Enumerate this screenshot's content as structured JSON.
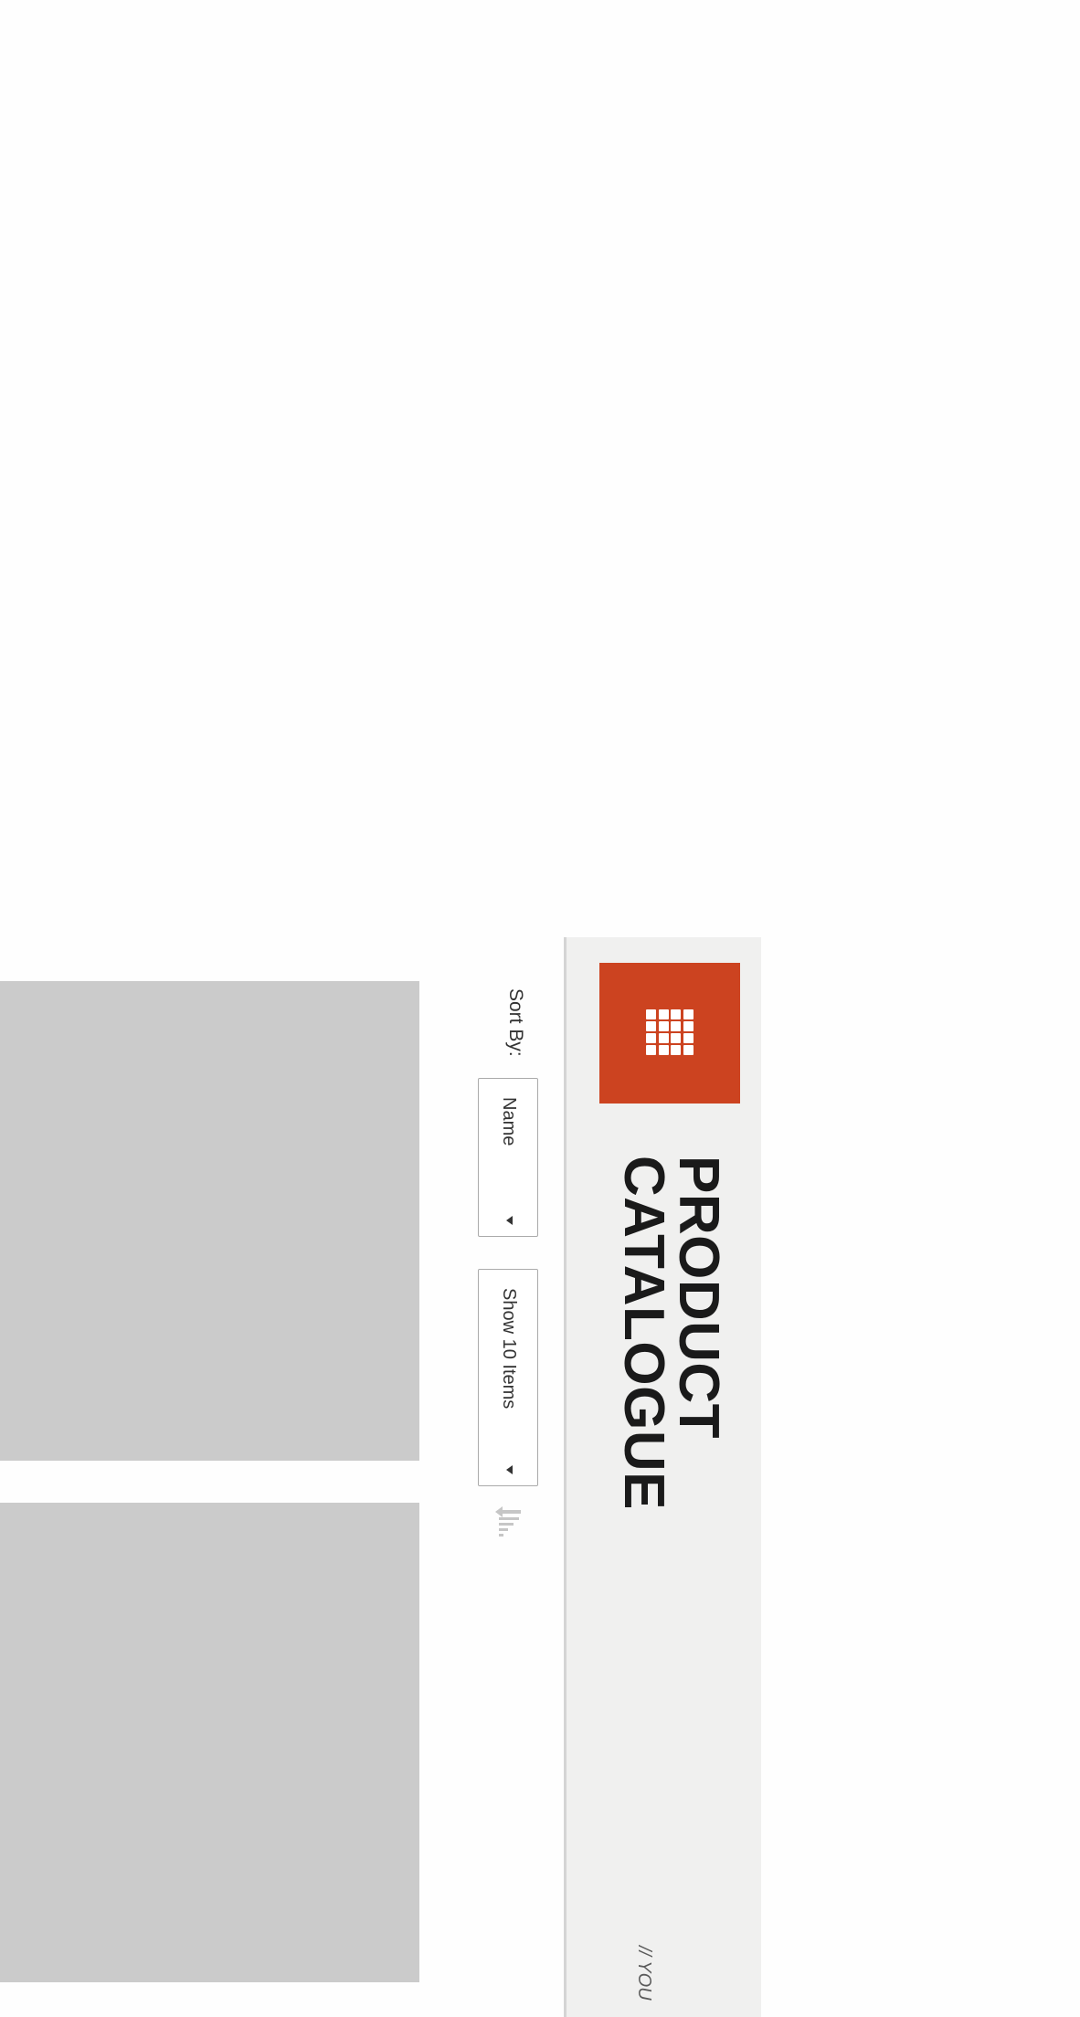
{
  "header": {
    "title_line1": "PRODUCT",
    "title_line2": "CATALOGUE",
    "tagline": "// YOU"
  },
  "toolbar": {
    "sort_label": "Sort By:",
    "sort_value": "Name",
    "count_value": "Show 10 Items"
  },
  "icons": {
    "brand": "grid-icon",
    "sort_direction": "sort-direction-icon",
    "dropdown": "caret-down-icon"
  },
  "colors": {
    "brand_accent": "#cc4320",
    "header_bg": "#f0f0ef",
    "card_placeholder": "#cbcbcb"
  }
}
